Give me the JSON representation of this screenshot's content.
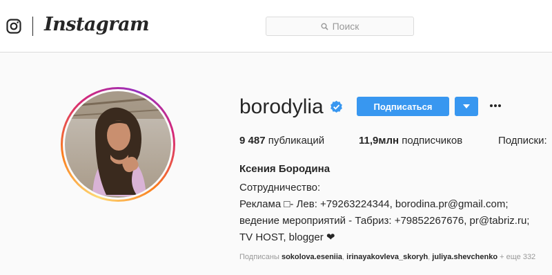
{
  "header": {
    "brand": "Instagram",
    "search_placeholder": "Поиск"
  },
  "profile": {
    "username": "borodylia",
    "verified": true,
    "follow_label": "Подписаться",
    "stats": [
      {
        "value": "9 487",
        "label": "публикаций"
      },
      {
        "value": "11,9млн",
        "label": "подписчиков"
      },
      {
        "value": "",
        "label": "Подписки:"
      }
    ],
    "full_name": "Ксения Бородина",
    "bio_lines": [
      "Сотрудничество:",
      "Реклама □- Лев: +79263224344, borodina.pr@gmail.com;",
      "ведение мероприятий - Табриз: +79852267676, pr@tabriz.ru;",
      "TV HOST, blogger ❤"
    ],
    "followed_by": {
      "prefix": "Подписаны",
      "users": [
        "sokolova.eseniia",
        "irinayakovleva_skoryh",
        "juliya.shevchenko"
      ],
      "more": "+ еще 332"
    }
  },
  "colors": {
    "accent": "#3897f0",
    "text": "#262626",
    "muted": "#999999",
    "background": "#fafafa"
  },
  "icons": [
    "instagram-logo-icon",
    "search-icon",
    "verified-badge-icon",
    "chevron-down-icon",
    "more-options-icon"
  ]
}
